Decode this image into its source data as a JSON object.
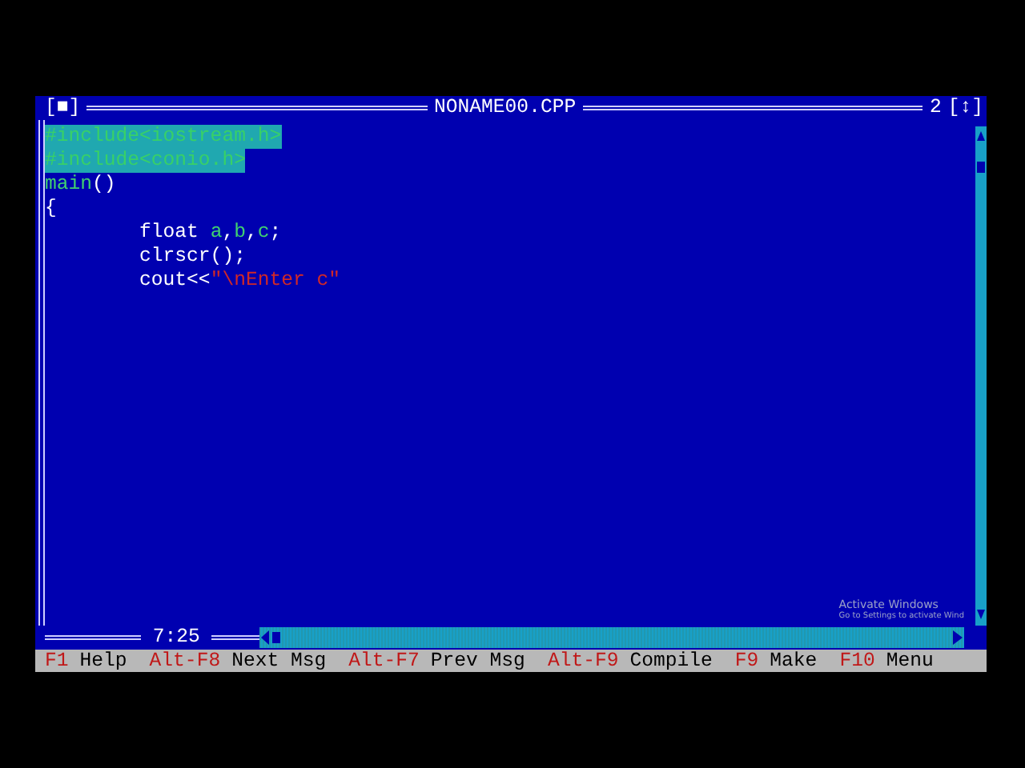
{
  "editor": {
    "close_box": "[■]",
    "title": "NONAME00.CPP",
    "window_number": "2",
    "zoom_box": "[↕]",
    "lines": [
      {
        "selected": true,
        "tokens": [
          {
            "text": "#include<iostream.h>",
            "kind": "directive"
          }
        ]
      },
      {
        "selected": true,
        "tokens": [
          {
            "text": "#include<conio.h>",
            "kind": "directive"
          }
        ]
      },
      {
        "selected": false,
        "tokens": [
          {
            "text": "main",
            "kind": "ident"
          },
          {
            "text": "()",
            "kind": "plain"
          }
        ]
      },
      {
        "selected": false,
        "tokens": [
          {
            "text": "{",
            "kind": "plain"
          }
        ]
      },
      {
        "selected": false,
        "tokens": [
          {
            "text": "        float ",
            "kind": "plain"
          },
          {
            "text": "a",
            "kind": "ident"
          },
          {
            "text": ",",
            "kind": "plain"
          },
          {
            "text": "b",
            "kind": "ident"
          },
          {
            "text": ",",
            "kind": "plain"
          },
          {
            "text": "c",
            "kind": "ident"
          },
          {
            "text": ";",
            "kind": "plain"
          }
        ]
      },
      {
        "selected": false,
        "tokens": [
          {
            "text": "        clrscr();",
            "kind": "plain"
          }
        ]
      },
      {
        "selected": false,
        "tokens": [
          {
            "text": "        cout<<",
            "kind": "plain"
          },
          {
            "text": "\"\\nEnter c\"",
            "kind": "string"
          }
        ]
      }
    ],
    "cursor_position": "7:25"
  },
  "os_notice": {
    "title": "Activate Windows",
    "text": "Go to Settings to activate Wind"
  },
  "status_bar": [
    {
      "key": "F1",
      "label": "Help"
    },
    {
      "key": "Alt-F8",
      "label": "Next Msg"
    },
    {
      "key": "Alt-F7",
      "label": "Prev Msg"
    },
    {
      "key": "Alt-F9",
      "label": "Compile"
    },
    {
      "key": "F9",
      "label": "Make"
    },
    {
      "key": "F10",
      "label": "Menu"
    }
  ]
}
